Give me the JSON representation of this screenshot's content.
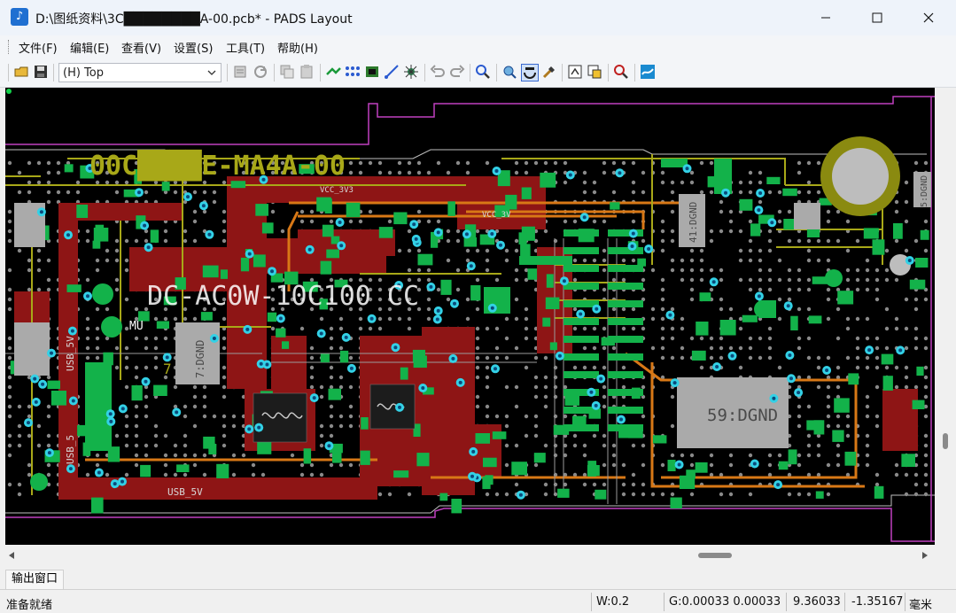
{
  "window": {
    "title": "D:\\图纸资料\\3C████████A-00.pcb* - PADS Layout",
    "app_icon": "pads-app-icon",
    "controls": [
      "minimize-icon",
      "maximize-icon",
      "close-icon"
    ]
  },
  "menu": {
    "items": [
      {
        "label": "文件(F)"
      },
      {
        "label": "编辑(E)"
      },
      {
        "label": "查看(V)"
      },
      {
        "label": "设置(S)"
      },
      {
        "label": "工具(T)"
      },
      {
        "label": "帮助(H)"
      }
    ]
  },
  "toolbar": {
    "layer_select": "(H) Top",
    "icons": [
      "open-icon",
      "save-icon",
      "layer-select",
      "properties-icon",
      "refresh-icon",
      "copy-icon",
      "paste-icon",
      "route-icon",
      "net-icon",
      "drc-icon",
      "trace-icon",
      "via-icon",
      "undo-icon",
      "redo-icon",
      "zoom-icon",
      "view-icon",
      "display-icon",
      "tool-icon",
      "report-icon",
      "window-icon",
      "find-icon",
      "layout-icon"
    ]
  },
  "pcb": {
    "labels": [
      {
        "text": "00C████E-MA4A-00",
        "kind": "silkscreen"
      },
      {
        "text": "DC-AC0W-10C100 CC",
        "kind": "silkscreen"
      },
      {
        "text": "VCC_3V3",
        "kind": "net"
      },
      {
        "text": "VCC_3V",
        "kind": "net"
      },
      {
        "text": "59:DGND",
        "kind": "pad"
      },
      {
        "text": "7:DGND",
        "kind": "pad"
      },
      {
        "text": "41:DGND",
        "kind": "pad"
      },
      {
        "text": "5:DGND",
        "kind": "pad"
      },
      {
        "text": "USB_5V",
        "kind": "net"
      },
      {
        "text": "USB_5V",
        "kind": "net"
      },
      {
        "text": "USB_5",
        "kind": "net"
      },
      {
        "text": "MU",
        "kind": "silkscreen"
      },
      {
        "text": "7",
        "kind": "silkscreen"
      }
    ],
    "colors": {
      "background": "#000000",
      "copper": "#9a1414",
      "pads": "#13b24a",
      "vias": "#33d1e6",
      "silk": "#b8b818",
      "outline": "#c040c0",
      "bottom": "#d87816"
    }
  },
  "output_tab": {
    "label": "输出窗口"
  },
  "status": {
    "ready": "准备就绪",
    "width": "W:0.2",
    "grid": "G:0.00033 0.00033",
    "x": "9.36033",
    "y": "-1.35167",
    "unit": "毫米"
  }
}
